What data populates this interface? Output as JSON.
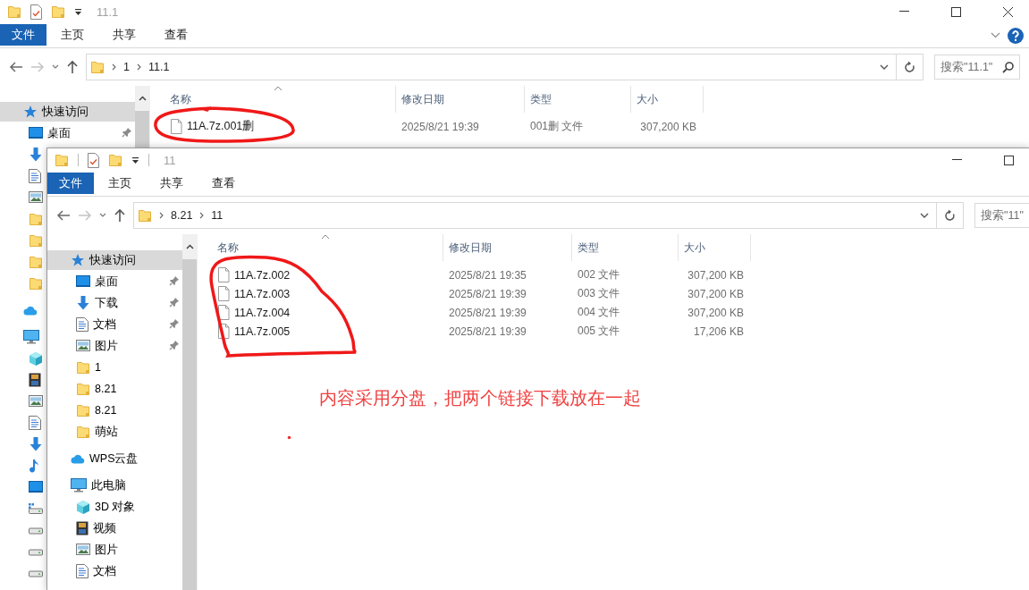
{
  "windows": [
    {
      "title": "11.1",
      "ribbon_tabs": [
        {
          "label": "文件",
          "kind": "menu"
        },
        {
          "label": "主页",
          "kind": "tab"
        },
        {
          "label": "共享",
          "kind": "tab"
        },
        {
          "label": "查看",
          "kind": "tab"
        }
      ],
      "window_buttons": [
        {
          "kind": "minimize"
        },
        {
          "kind": "maximize"
        },
        {
          "kind": "close"
        }
      ],
      "ribbon_extras": true,
      "path": [
        "1",
        "11.1"
      ],
      "search": {
        "placeholder": "搜索\"11.1\""
      },
      "nav": [
        {
          "label": "快速访问",
          "kind": "star",
          "selected": true,
          "children": [
            {
              "label": "桌面",
              "kind": "desktop",
              "pinned": true
            },
            {
              "kind": "download"
            },
            {
              "kind": "document"
            },
            {
              "kind": "picture"
            },
            {
              "kind": "folder"
            },
            {
              "kind": "folder"
            },
            {
              "kind": "folder"
            },
            {
              "kind": "folder"
            }
          ]
        },
        {
          "kind": "cloud",
          "selected": false
        },
        {
          "kind": "computer",
          "selected": false,
          "children": [
            {
              "kind": "cube"
            },
            {
              "kind": "video"
            },
            {
              "kind": "picture"
            },
            {
              "kind": "document"
            },
            {
              "kind": "download"
            },
            {
              "kind": "music"
            },
            {
              "kind": "desktop"
            },
            {
              "kind": "system-drive"
            },
            {
              "kind": "drive"
            },
            {
              "kind": "drive"
            },
            {
              "kind": "drive"
            }
          ]
        }
      ],
      "columns": [
        "名称",
        "修改日期",
        "类型",
        "大小"
      ],
      "files": [
        {
          "name": "11A.7z.001删",
          "modified": "2025/8/21 19:39",
          "type": "001删 文件",
          "size": "307,200 KB"
        }
      ]
    },
    {
      "title": "11",
      "ribbon_tabs": [
        {
          "label": "文件",
          "kind": "menu"
        },
        {
          "label": "主页",
          "kind": "tab"
        },
        {
          "label": "共享",
          "kind": "tab"
        },
        {
          "label": "查看",
          "kind": "tab"
        }
      ],
      "window_buttons": [
        {
          "kind": "minimize"
        },
        {
          "kind": "maximize"
        }
      ],
      "ribbon_extras": false,
      "path": [
        "8.21",
        "11"
      ],
      "search": {
        "placeholder": "搜索\"11\""
      },
      "nav": [
        {
          "label": "快速访问",
          "kind": "star",
          "selected": true,
          "children": [
            {
              "label": "桌面",
              "kind": "desktop",
              "pinned": true
            },
            {
              "label": "下载",
              "kind": "download",
              "pinned": true
            },
            {
              "label": "文档",
              "kind": "document",
              "pinned": true
            },
            {
              "label": "图片",
              "kind": "picture",
              "pinned": true
            },
            {
              "label": "1",
              "kind": "folder",
              "pinned": false
            },
            {
              "label": "8.21",
              "kind": "folder",
              "pinned": false
            },
            {
              "label": "8.21",
              "kind": "folder",
              "pinned": false
            },
            {
              "label": "萌站",
              "kind": "folder",
              "pinned": false
            }
          ]
        },
        {
          "label": "WPS云盘",
          "kind": "cloud",
          "selected": false
        },
        {
          "label": "此电脑",
          "kind": "computer",
          "selected": false,
          "children": [
            {
              "label": "3D 对象",
              "kind": "cube",
              "pinned": false
            },
            {
              "label": "视频",
              "kind": "video",
              "pinned": false
            },
            {
              "label": "图片",
              "kind": "picture",
              "pinned": false
            },
            {
              "label": "文档",
              "kind": "document",
              "pinned": false
            }
          ]
        }
      ],
      "columns": [
        "名称",
        "修改日期",
        "类型",
        "大小"
      ],
      "files": [
        {
          "name": "11A.7z.002",
          "modified": "2025/8/21 19:35",
          "type": "002 文件",
          "size": "307,200 KB"
        },
        {
          "name": "11A.7z.003",
          "modified": "2025/8/21 19:39",
          "type": "003 文件",
          "size": "307,200 KB"
        },
        {
          "name": "11A.7z.004",
          "modified": "2025/8/21 19:39",
          "type": "004 文件",
          "size": "307,200 KB"
        },
        {
          "name": "11A.7z.005",
          "modified": "2025/8/21 19:39",
          "type": "005 文件",
          "size": "17,206 KB"
        }
      ]
    }
  ],
  "annotation": {
    "note": "内容采用分盘，把两个链接下载放在一起"
  }
}
